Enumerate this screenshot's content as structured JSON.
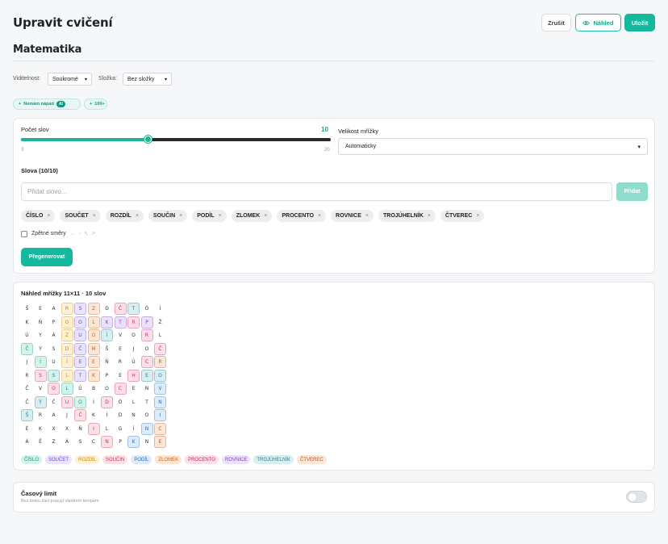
{
  "header": {
    "title": "Upravit cvičení",
    "cancel_label": "Zrušit",
    "preview_label": "Náhled",
    "save_label": "Uložit"
  },
  "subject": "Matematika",
  "filters": {
    "visibility_label": "Viditelnost:",
    "visibility_value": "Soukromé",
    "folder_label": "Složka:",
    "folder_value": "Bez složky"
  },
  "suggestions": {
    "idea_label": "Nemám nápad",
    "ai_badge": "AI",
    "more_label": "100+"
  },
  "settings": {
    "word_count_label": "Počet slov",
    "word_count_value": "10",
    "slider_min": "3",
    "slider_max": "20",
    "slider_fraction": 0.412,
    "grid_size_label": "Velikost mřížky",
    "grid_size_value": "Automaticky",
    "words_heading": "Slova (10/10)",
    "add_placeholder": "Přidat slovo...",
    "add_button": "Přidat",
    "reverse_label": "Zpětné směry",
    "reverse_arrows": "← ↑ ↖ ↗",
    "regenerate_label": "Přegenerovat"
  },
  "words": [
    "ČÍSLO",
    "SOUČET",
    "ROZDÍL",
    "SOUČIN",
    "PODÍL",
    "ZLOMEK",
    "PROCENTO",
    "ROVNICE",
    "TROJÚHELNÍK",
    "ČTVEREC"
  ],
  "preview": {
    "title": "Náhled mřížky 11×11 · 10 slov",
    "rows": [
      "ŠEARSZDČTÓÍ",
      "KŇPOOLKTRPŽ",
      "ÚYÁZUOÍVORL",
      "ČÝSDČMŠEJOČ",
      "JÍUÍEEŇRÚCR",
      "RSSLTKPEHEO",
      "ČVOLÚBOCENV",
      "ČÝČUOÍDÓLTN",
      "ŠRAJČKÍDNOI",
      "ÉKXXŇILGÍNC",
      "ÁĚZÁSCNPKNE"
    ],
    "highlights": [
      {
        "word": 0,
        "cells": [
          [
            3,
            0
          ],
          [
            4,
            1
          ],
          [
            5,
            2
          ],
          [
            6,
            3
          ],
          [
            7,
            4
          ]
        ]
      },
      {
        "word": 1,
        "cells": [
          [
            0,
            4
          ],
          [
            1,
            4
          ],
          [
            2,
            4
          ],
          [
            3,
            4
          ],
          [
            4,
            4
          ],
          [
            5,
            4
          ]
        ]
      },
      {
        "word": 2,
        "cells": [
          [
            0,
            3
          ],
          [
            1,
            3
          ],
          [
            2,
            3
          ],
          [
            3,
            3
          ],
          [
            4,
            3
          ],
          [
            5,
            3
          ]
        ]
      },
      {
        "word": 3,
        "cells": [
          [
            5,
            1
          ],
          [
            6,
            2
          ],
          [
            7,
            3
          ],
          [
            8,
            4
          ],
          [
            9,
            5
          ],
          [
            10,
            6
          ]
        ]
      },
      {
        "word": 4,
        "cells": [
          [
            10,
            8
          ],
          [
            9,
            9
          ],
          [
            8,
            10
          ],
          [
            7,
            10
          ],
          [
            6,
            10
          ]
        ]
      },
      {
        "word": 5,
        "cells": [
          [
            0,
            5
          ],
          [
            1,
            5
          ],
          [
            2,
            5
          ],
          [
            3,
            5
          ],
          [
            4,
            5
          ],
          [
            5,
            5
          ]
        ]
      },
      {
        "word": 6,
        "cells": [
          [
            0,
            7
          ],
          [
            1,
            8
          ],
          [
            2,
            9
          ],
          [
            3,
            10
          ],
          [
            4,
            9
          ],
          [
            5,
            8
          ],
          [
            6,
            7
          ],
          [
            7,
            6
          ]
        ]
      },
      {
        "word": 7,
        "cells": [
          [
            1,
            9
          ],
          [
            1,
            8
          ],
          [
            1,
            7
          ],
          [
            1,
            6
          ],
          [
            1,
            5
          ],
          [
            1,
            4
          ],
          [
            1,
            3
          ]
        ]
      },
      {
        "word": 8,
        "cells": [
          [
            0,
            8
          ],
          [
            1,
            7
          ],
          [
            2,
            6
          ],
          [
            3,
            5
          ],
          [
            4,
            4
          ],
          [
            5,
            3
          ],
          [
            6,
            2
          ],
          [
            7,
            1
          ],
          [
            8,
            0
          ],
          [
            5,
            9
          ],
          [
            5,
            10
          ]
        ]
      },
      {
        "word": 9,
        "cells": [
          [
            4,
            10
          ],
          [
            5,
            10
          ],
          [
            6,
            10
          ],
          [
            7,
            10
          ],
          [
            8,
            10
          ],
          [
            9,
            10
          ],
          [
            10,
            10
          ]
        ]
      }
    ]
  },
  "palette": [
    {
      "bg": "#d5f3ec",
      "fg": "#16967e"
    },
    {
      "bg": "#e9e3fb",
      "fg": "#6b4fc6"
    },
    {
      "bg": "#fdf0d5",
      "fg": "#c98a12"
    },
    {
      "bg": "#fbe0e6",
      "fg": "#c8365a"
    },
    {
      "bg": "#dcecfb",
      "fg": "#2d6fb8"
    },
    {
      "bg": "#fde6d6",
      "fg": "#c2631d"
    },
    {
      "bg": "#fcdfe8",
      "fg": "#c22d63"
    },
    {
      "bg": "#ece1fb",
      "fg": "#7a42c8"
    },
    {
      "bg": "#d8eef0",
      "fg": "#2a7f8a"
    },
    {
      "bg": "#fbe6d8",
      "fg": "#b8562a"
    }
  ],
  "time_limit": {
    "title": "Časový limit",
    "subtitle": "Bez limitu žáci pracují vlastním tempem"
  }
}
